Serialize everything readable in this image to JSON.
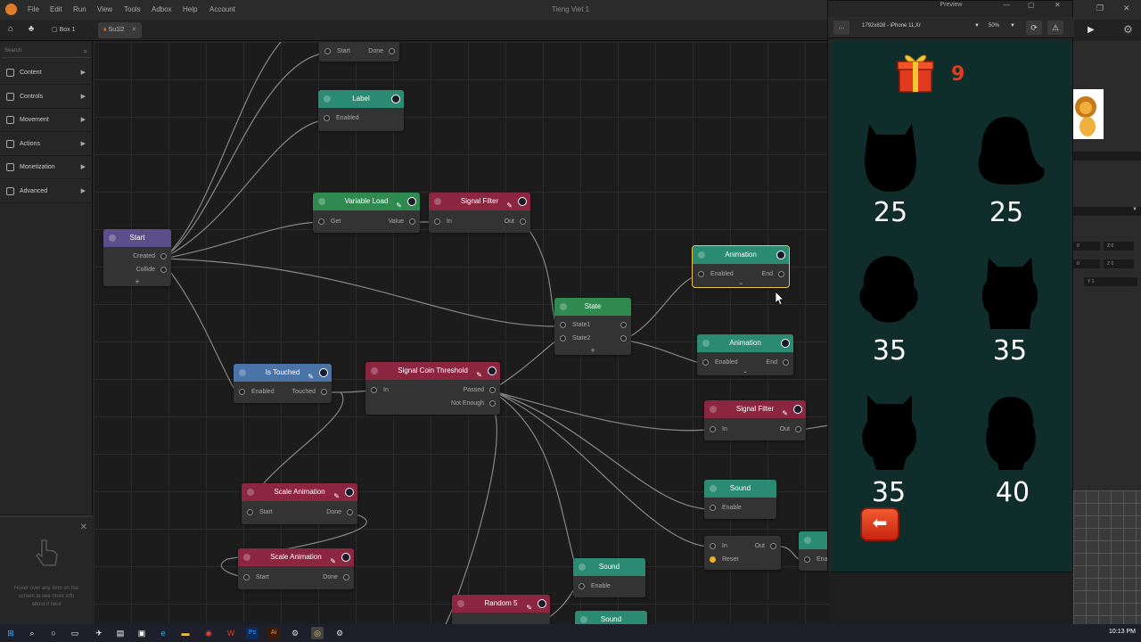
{
  "window": {
    "title": "Tieng Viet 1"
  },
  "menu": [
    "File",
    "Edit",
    "Run",
    "View",
    "Tools",
    "Adbox",
    "Help",
    "Account"
  ],
  "tabs": [
    {
      "label": "Box 1"
    },
    {
      "label": "Su1l2"
    }
  ],
  "sidebar": {
    "search_placeholder": "Search",
    "categories": [
      "Content",
      "Controls",
      "Movement",
      "Actions",
      "Monetization",
      "Advanced"
    ]
  },
  "info_panel": {
    "text": "Hover over any item on the screen to see more info about it here"
  },
  "nodes": {
    "top_partial": {
      "in": "Start",
      "out": "Done"
    },
    "label": {
      "title": "Label",
      "in": "Enabled"
    },
    "start": {
      "title": "Start",
      "out1": "Created",
      "out2": "Collide",
      "plus": "+"
    },
    "variable_load": {
      "title": "Variable Load",
      "in": "Get",
      "out": "Value"
    },
    "signal_filter_1": {
      "title": "Signal Filter",
      "in": "In",
      "out": "Out"
    },
    "animation_1": {
      "title": "Animation",
      "in": "Enabled",
      "out": "End"
    },
    "state": {
      "title": "State",
      "out1": "State1",
      "out2": "State2",
      "plus": "+"
    },
    "animation_2": {
      "title": "Animation",
      "in": "Enabled",
      "out": "End"
    },
    "is_touched": {
      "title": "Is Touched",
      "in": "Enabled",
      "out": "Touched"
    },
    "signal_coin_threshold": {
      "title": "Signal Coin Threshold",
      "in": "In",
      "out1": "Passed",
      "out2": "Not Enough"
    },
    "signal_filter_2": {
      "title": "Signal Filter",
      "in": "In",
      "out": "Out"
    },
    "sound_1": {
      "title": "Sound",
      "in": "Enable"
    },
    "scale_animation_1": {
      "title": "Scale Animation",
      "in": "Start",
      "out": "Done"
    },
    "scale_animation_2": {
      "title": "Scale Animation",
      "in": "Start",
      "out": "Done"
    },
    "unnamed": {
      "in1": "In",
      "in2": "Reset",
      "out": "Out"
    },
    "partial_right": {
      "in": "Ena"
    },
    "sound_2": {
      "title": "Sound",
      "in": "Enable"
    },
    "sound_3": {
      "title": "Sound"
    },
    "random": {
      "title": "Random 5"
    }
  },
  "preview": {
    "title": "Preview",
    "more": "...",
    "device": "1792x828 - iPhone 11,Xr",
    "zoom": "50%",
    "coins": "9",
    "prices": [
      "25",
      "25",
      "35",
      "35",
      "35",
      "40"
    ],
    "back_glyph": "⬅"
  },
  "rightpanel": {
    "fields": [
      "0",
      "Z 0",
      "0",
      "Z 0",
      "Y 1"
    ]
  },
  "taskbar": {
    "clock": "10:13 PM"
  },
  "colors": {
    "green": "#2e8a4f",
    "red": "#8b2540",
    "purple": "#5a4f8a",
    "blue": "#4a74a8",
    "teal": "#2a8a72"
  }
}
